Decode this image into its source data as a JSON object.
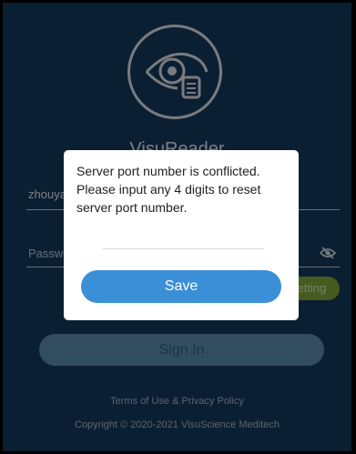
{
  "login": {
    "app_name": "VisuReader",
    "username_value": "zhouyang",
    "password_placeholder": "Password",
    "setting_label": "Setting",
    "signin_label": "Sign In",
    "terms_text": "Terms of Use & Privacy Policy",
    "copyright_text": "Copyright © 2020-2021 VisuScience Meditech"
  },
  "dialog": {
    "message": "Server port number is conflicted. Please input any 4 digits to reset server port number.",
    "input_value": "",
    "save_label": "Save"
  },
  "icons": {
    "logo": "eye-document-icon",
    "password_toggle": "eye-slash-icon"
  },
  "colors": {
    "background": "#153a5d",
    "save_button": "#3a8fd6",
    "setting_button": "#7fa63a",
    "signin_button": "#5e8cb0"
  }
}
